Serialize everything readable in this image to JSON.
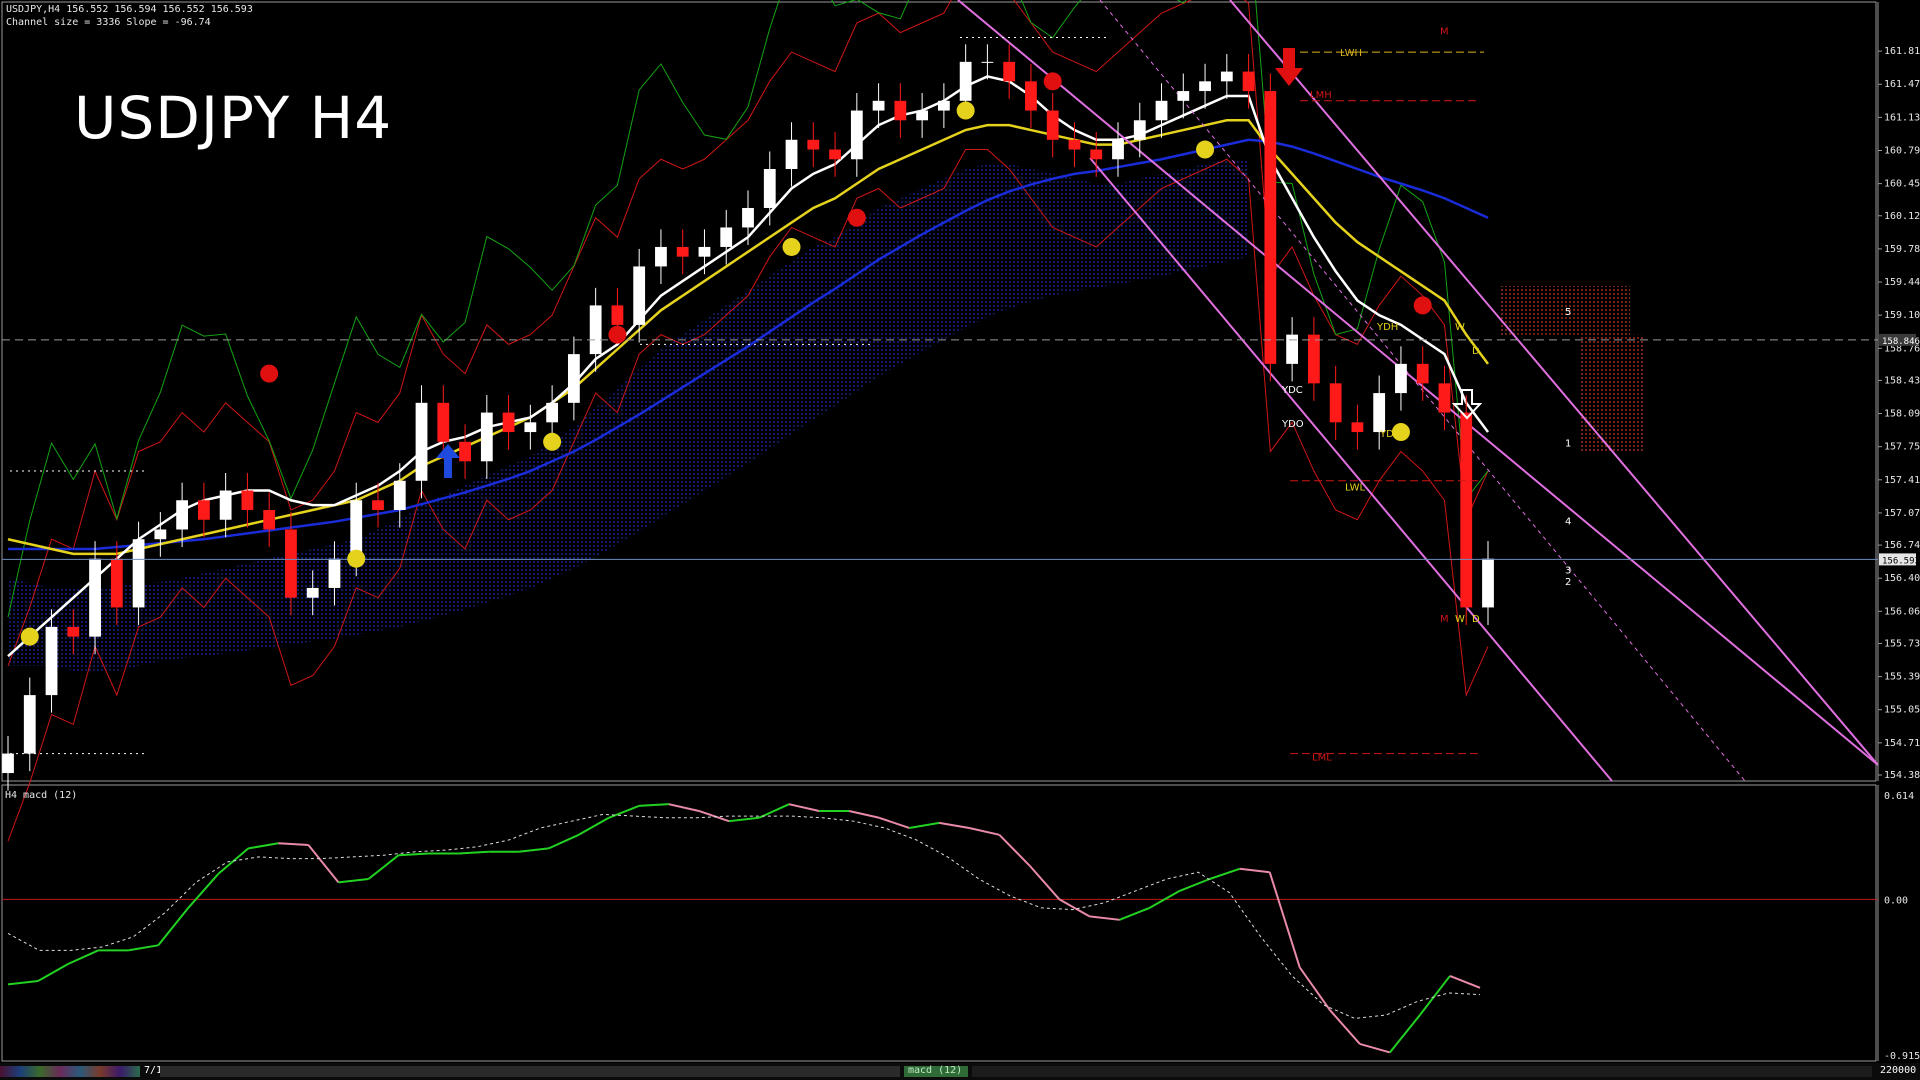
{
  "window": {
    "symbol_line": "USDJPY,H4  156.552 156.594 156.552 156.593",
    "channel_line": "Channel size = 3336 Slope = -96.74",
    "big_title": "USDJPY H4",
    "macd_title": "H4  macd (12)",
    "date_label": "7/15",
    "tab_label": "macd (12)",
    "corner_value": "220000"
  },
  "colors": {
    "background": "#000000",
    "bull_candle": "#ffffff",
    "bear_candle": "#ff1a1a",
    "ema_white": "#ffffff",
    "ema_yellow": "#e5d21d",
    "ema_blue": "#1a2bd8",
    "cloud_fill": "#1d2fbf",
    "cloud_bear": "#c93a2a",
    "bollinger": "#d01616",
    "chikou": "#13a313",
    "channel": "#e070e0",
    "macd_up": "#22d222",
    "macd_down": "#e88aa8",
    "macd_signal": "#dddddd"
  },
  "chart_data": [
    {
      "type": "candlestick",
      "title": "USDJPY H4",
      "ylim": [
        154.38,
        162.15
      ],
      "y_ticks": [
        "161.810",
        "161.470",
        "161.130",
        "160.790",
        "160.450",
        "160.120",
        "159.780",
        "159.440",
        "159.100",
        "158.760",
        "158.430",
        "158.090",
        "157.750",
        "157.410",
        "157.070",
        "156.740",
        "156.400",
        "156.060",
        "155.730",
        "155.390",
        "155.050",
        "154.710",
        "154.380"
      ],
      "current_price": "156.593",
      "dashed_level": "158.846",
      "close_series": [
        154.6,
        155.2,
        155.9,
        155.8,
        156.6,
        156.1,
        156.8,
        156.9,
        157.2,
        157.0,
        157.3,
        157.1,
        156.9,
        156.2,
        156.3,
        156.6,
        157.2,
        157.1,
        157.4,
        158.2,
        157.8,
        157.6,
        158.1,
        157.9,
        158.0,
        158.2,
        158.7,
        159.2,
        159.0,
        159.6,
        159.8,
        159.7,
        159.8,
        160.0,
        160.2,
        160.6,
        160.9,
        160.8,
        160.7,
        161.2,
        161.3,
        161.1,
        161.2,
        161.3,
        161.7,
        161.7,
        161.5,
        161.2,
        160.9,
        160.8,
        160.7,
        160.9,
        161.1,
        161.3,
        161.4,
        161.5,
        161.6,
        161.4,
        158.6,
        158.9,
        158.4,
        158.0,
        157.9,
        158.3,
        158.6,
        158.4,
        158.1,
        156.1,
        156.6
      ],
      "overlays": {
        "ema_white": [
          155.6,
          155.8,
          156.0,
          156.2,
          156.4,
          156.6,
          156.8,
          156.95,
          157.1,
          157.2,
          157.25,
          157.3,
          157.3,
          157.2,
          157.15,
          157.15,
          157.25,
          157.35,
          157.5,
          157.7,
          157.8,
          157.85,
          157.95,
          158.0,
          158.05,
          158.2,
          158.4,
          158.65,
          158.8,
          159.05,
          159.3,
          159.45,
          159.6,
          159.75,
          159.9,
          160.15,
          160.4,
          160.55,
          160.65,
          160.85,
          161.05,
          161.15,
          161.2,
          161.3,
          161.45,
          161.55,
          161.5,
          161.35,
          161.15,
          161.0,
          160.9,
          160.9,
          160.95,
          161.05,
          161.15,
          161.25,
          161.35,
          161.35,
          160.7,
          160.3,
          159.9,
          159.55,
          159.25,
          159.1,
          159.0,
          158.85,
          158.7,
          158.2,
          157.9
        ],
        "ema_yellow": [
          156.8,
          156.75,
          156.7,
          156.65,
          156.65,
          156.65,
          156.7,
          156.75,
          156.8,
          156.85,
          156.9,
          156.95,
          157.0,
          157.05,
          157.1,
          157.15,
          157.2,
          157.3,
          157.4,
          157.55,
          157.65,
          157.75,
          157.85,
          157.95,
          158.05,
          158.2,
          158.35,
          158.55,
          158.75,
          158.95,
          159.15,
          159.3,
          159.45,
          159.6,
          159.75,
          159.9,
          160.05,
          160.2,
          160.3,
          160.45,
          160.6,
          160.7,
          160.8,
          160.9,
          161.0,
          161.05,
          161.05,
          161.0,
          160.95,
          160.9,
          160.85,
          160.85,
          160.9,
          160.95,
          161.0,
          161.05,
          161.1,
          161.1,
          160.8,
          160.55,
          160.3,
          160.05,
          159.85,
          159.7,
          159.55,
          159.4,
          159.25,
          158.9,
          158.6
        ],
        "ema_blue": [
          156.7,
          156.7,
          156.7,
          156.7,
          156.7,
          156.72,
          156.74,
          156.76,
          156.78,
          156.8,
          156.83,
          156.86,
          156.89,
          156.92,
          156.95,
          156.98,
          157.02,
          157.06,
          157.1,
          157.16,
          157.22,
          157.28,
          157.35,
          157.42,
          157.5,
          157.6,
          157.7,
          157.82,
          157.95,
          158.08,
          158.22,
          158.36,
          158.5,
          158.64,
          158.78,
          158.93,
          159.08,
          159.23,
          159.37,
          159.52,
          159.67,
          159.8,
          159.93,
          160.05,
          160.17,
          160.28,
          160.37,
          160.44,
          160.5,
          160.55,
          160.58,
          160.62,
          160.66,
          160.7,
          160.75,
          160.8,
          160.85,
          160.9,
          160.88,
          160.83,
          160.76,
          160.68,
          160.6,
          160.52,
          160.45,
          160.38,
          160.3,
          160.2,
          160.1
        ]
      },
      "text_labels": [
        "LWH",
        "LMH",
        "M",
        "YDH",
        "W",
        "D",
        "YDC",
        "YDO",
        "YDL",
        "LWL",
        "LML",
        "M",
        "W",
        "D",
        "1",
        "2",
        "3",
        "4",
        "5"
      ]
    },
    {
      "type": "line",
      "title": "H4  macd (12)",
      "ylim": [
        -0.915,
        0.614
      ],
      "y_ticks": [
        "0.614",
        "0.00",
        "-0.915"
      ],
      "zero_line": 0,
      "macd": [
        -0.5,
        -0.48,
        -0.38,
        -0.3,
        -0.3,
        -0.27,
        -0.05,
        0.15,
        0.3,
        0.33,
        0.32,
        0.1,
        0.12,
        0.26,
        0.27,
        0.27,
        0.28,
        0.28,
        0.3,
        0.38,
        0.48,
        0.55,
        0.56,
        0.52,
        0.46,
        0.48,
        0.56,
        0.52,
        0.52,
        0.48,
        0.42,
        0.45,
        0.42,
        0.38,
        0.2,
        0.0,
        -0.1,
        -0.12,
        -0.05,
        0.05,
        0.12,
        0.18,
        0.16,
        -0.4,
        -0.65,
        -0.85,
        -0.9,
        -0.68,
        -0.45,
        -0.52
      ],
      "signal": [
        -0.2,
        -0.3,
        -0.3,
        -0.28,
        -0.22,
        -0.08,
        0.1,
        0.22,
        0.25,
        0.24,
        0.24,
        0.25,
        0.26,
        0.28,
        0.29,
        0.31,
        0.35,
        0.42,
        0.46,
        0.5,
        0.49,
        0.48,
        0.48,
        0.49,
        0.49,
        0.49,
        0.48,
        0.46,
        0.42,
        0.35,
        0.25,
        0.12,
        0.02,
        -0.05,
        -0.06,
        -0.02,
        0.05,
        0.12,
        0.16,
        0.04,
        -0.22,
        -0.45,
        -0.62,
        -0.7,
        -0.68,
        -0.6,
        -0.55,
        -0.56
      ]
    }
  ]
}
